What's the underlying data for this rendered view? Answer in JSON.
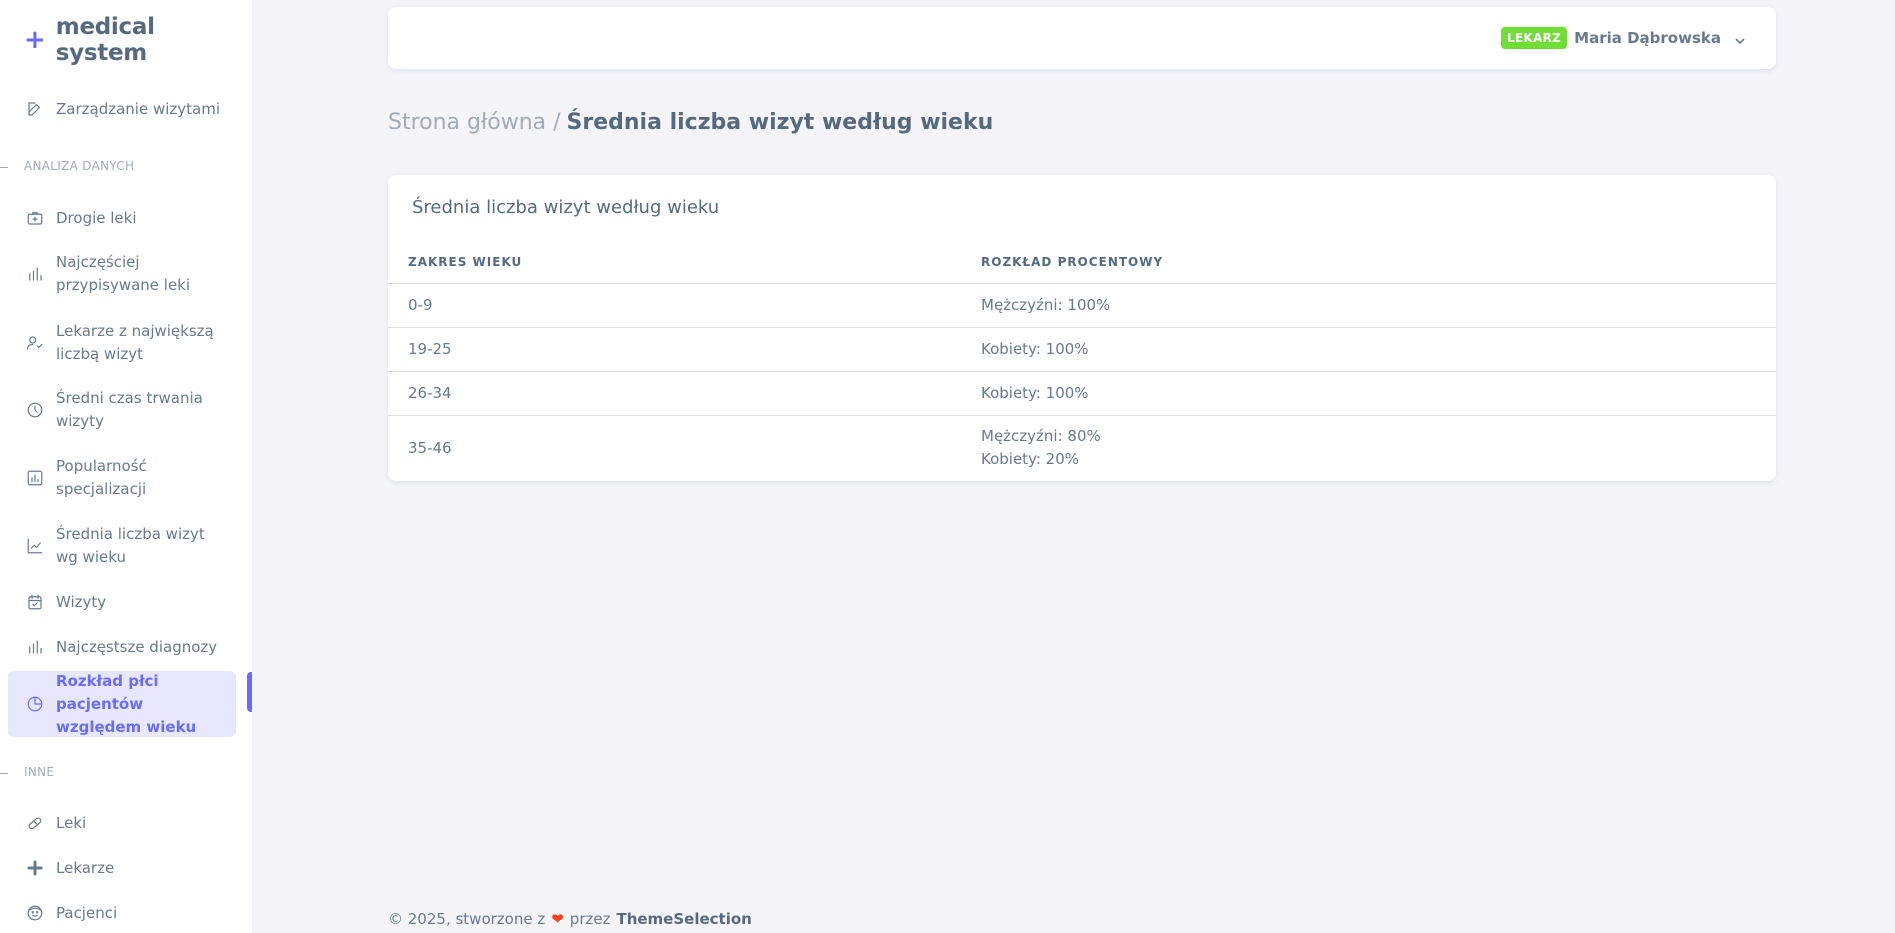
{
  "brand": {
    "symbol": "+",
    "name": "medical system"
  },
  "sidebar": {
    "top_item": {
      "label": "Zarządzanie wizytami",
      "icon": "edit-icon"
    },
    "sections": [
      {
        "header": "ANALIZA DANYCH",
        "items": [
          {
            "label": "Drogie leki",
            "icon": "briefcase-medical-icon"
          },
          {
            "label": "Najczęściej przypisywane leki",
            "icon": "bar-chart-icon"
          },
          {
            "label": "Lekarze z największą liczbą wizyt",
            "icon": "user-check-icon"
          },
          {
            "label": "Średni czas trwania wizyty",
            "icon": "clock-icon"
          },
          {
            "label": "Popularność specjalizacji",
            "icon": "bar-chart-box-icon"
          },
          {
            "label": "Średnia liczba wizyt wg wieku",
            "icon": "line-chart-icon"
          },
          {
            "label": "Wizyty",
            "icon": "calendar-check-icon"
          },
          {
            "label": "Najczęstsze diagnozy",
            "icon": "bar-chart-icon"
          },
          {
            "label": "Rozkład płci pacjentów względem wieku",
            "icon": "pie-chart-icon",
            "active": true
          }
        ]
      },
      {
        "header": "INNE",
        "items": [
          {
            "label": "Leki",
            "icon": "pill-icon"
          },
          {
            "label": "Lekarze",
            "icon": "plus-icon"
          },
          {
            "label": "Pacjenci",
            "icon": "face-icon"
          }
        ]
      }
    ]
  },
  "navbar": {
    "role_badge": "LEKARZ",
    "user_name": "Maria Dąbrowska",
    "dropdown_icon": "chevron-down-icon"
  },
  "breadcrumb": {
    "home": "Strona główna /",
    "current": "Średnia liczba wizyt według wieku"
  },
  "card": {
    "title": "Średnia liczba wizyt według wieku",
    "columns": [
      "ZAKRES WIEKU",
      "ROZKŁAD PROCENTOWY"
    ],
    "rows": [
      {
        "range": "0-9",
        "distribution": [
          "Mężczyźni: 100%"
        ]
      },
      {
        "range": "19-25",
        "distribution": [
          "Kobiety: 100%"
        ]
      },
      {
        "range": "26-34",
        "distribution": [
          "Kobiety: 100%"
        ]
      },
      {
        "range": "35-46",
        "distribution": [
          "Mężczyźni: 80%",
          "Kobiety: 20%"
        ]
      }
    ]
  },
  "footer": {
    "prefix": "© 2025, stworzone z",
    "heart_icon": "heart-icon",
    "by": "przez",
    "author": "ThemeSelection"
  },
  "colors": {
    "accent": "#696cff",
    "badge": "#71dd37",
    "text": "#566a7f",
    "muted": "#a1acb8",
    "background": "#f5f5f9"
  }
}
